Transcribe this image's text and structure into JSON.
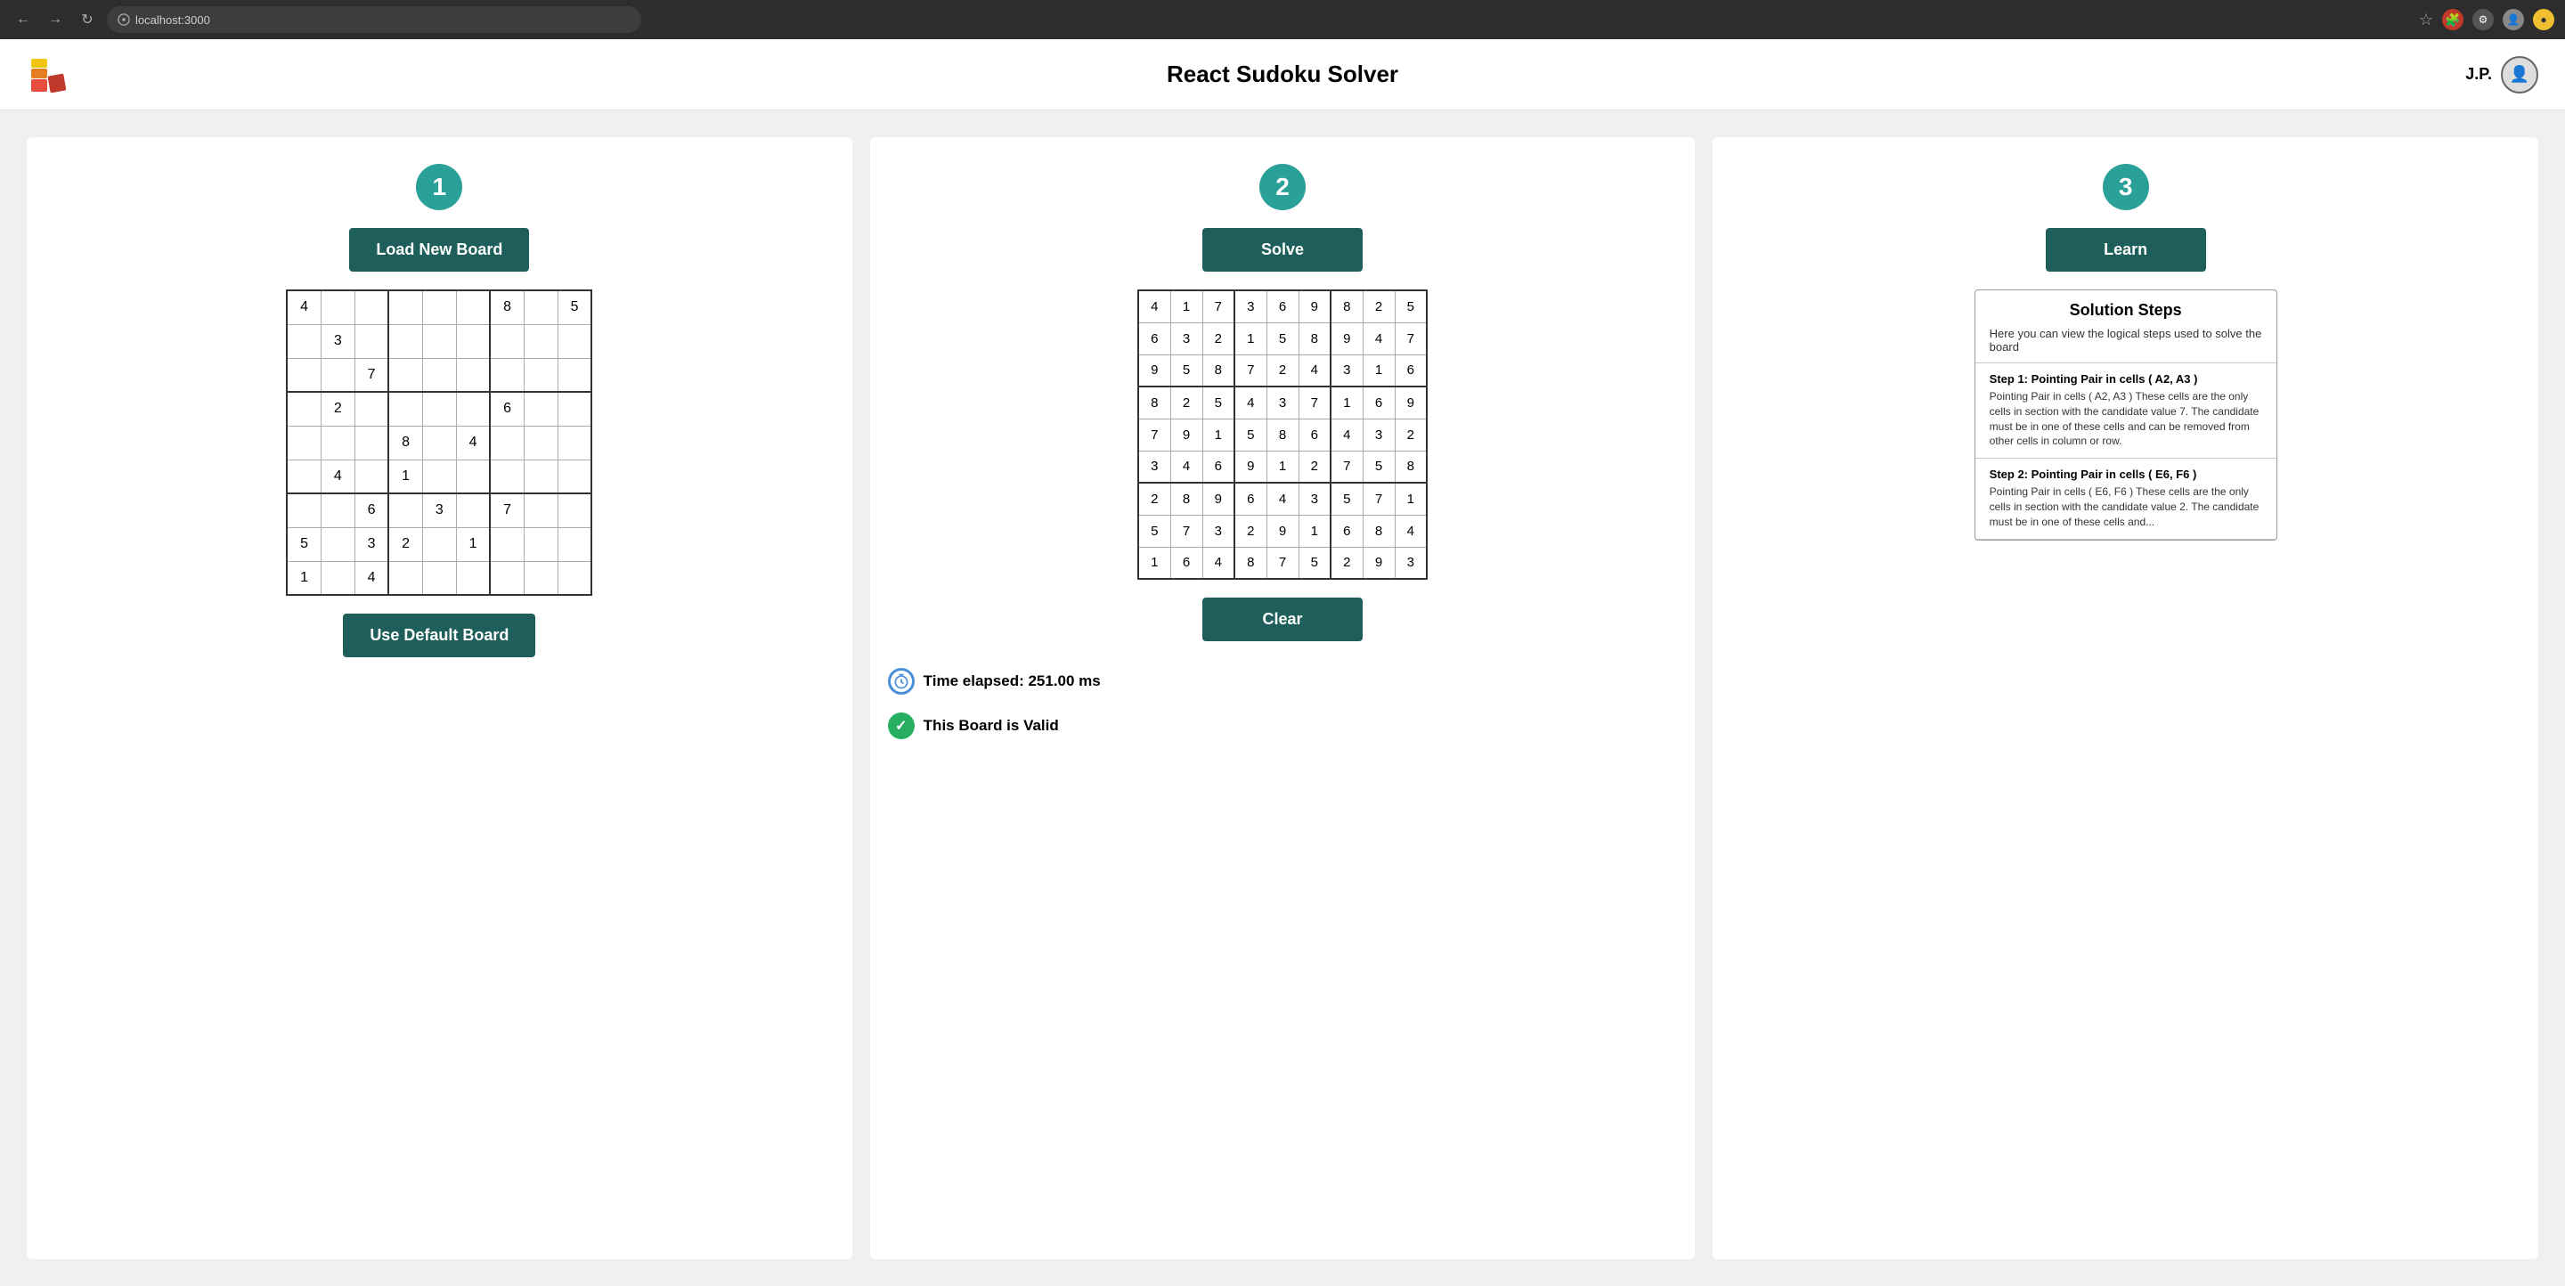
{
  "browser": {
    "url": "localhost:3000",
    "back": "←",
    "forward": "→",
    "reload": "↻"
  },
  "header": {
    "title": "React Sudoku Solver",
    "user_initials": "J.P."
  },
  "panel1": {
    "step": "1",
    "load_btn": "Load New Board",
    "default_btn": "Use Default Board",
    "grid": [
      [
        "4",
        "",
        "",
        "",
        "",
        "",
        "8",
        "",
        "5"
      ],
      [
        "",
        "3",
        "",
        "",
        "",
        "",
        "",
        "",
        ""
      ],
      [
        "",
        "",
        "7",
        "",
        "",
        "",
        "",
        "",
        ""
      ],
      [
        "",
        "2",
        "",
        "",
        "",
        "",
        "6",
        "",
        ""
      ],
      [
        "",
        "",
        "",
        "8",
        "",
        "4",
        "",
        "",
        ""
      ],
      [
        "",
        "4",
        "",
        "1",
        "",
        "",
        "",
        "",
        ""
      ],
      [
        "",
        "",
        "6",
        "",
        "3",
        "",
        "7",
        "",
        ""
      ],
      [
        "5",
        "",
        "3",
        "2",
        "",
        "1",
        "",
        "",
        ""
      ],
      [
        "1",
        "",
        "4",
        "",
        "",
        "",
        "",
        "",
        ""
      ]
    ]
  },
  "panel2": {
    "step": "2",
    "solve_btn": "Solve",
    "clear_btn": "Clear",
    "solved_grid": [
      [
        "4",
        "1",
        "7",
        "3",
        "6",
        "9",
        "8",
        "2",
        "5"
      ],
      [
        "6",
        "3",
        "2",
        "1",
        "5",
        "8",
        "9",
        "4",
        "7"
      ],
      [
        "9",
        "5",
        "8",
        "7",
        "2",
        "4",
        "3",
        "1",
        "6"
      ],
      [
        "8",
        "2",
        "5",
        "4",
        "3",
        "7",
        "1",
        "6",
        "9"
      ],
      [
        "7",
        "9",
        "1",
        "5",
        "8",
        "6",
        "4",
        "3",
        "2"
      ],
      [
        "3",
        "4",
        "6",
        "9",
        "1",
        "2",
        "7",
        "5",
        "8"
      ],
      [
        "2",
        "8",
        "9",
        "6",
        "4",
        "3",
        "5",
        "7",
        "1"
      ],
      [
        "5",
        "7",
        "3",
        "2",
        "9",
        "1",
        "6",
        "8",
        "4"
      ],
      [
        "1",
        "6",
        "4",
        "8",
        "7",
        "5",
        "2",
        "9",
        "3"
      ]
    ],
    "timer_label": "Time elapsed: 251.00 ms",
    "valid_label": "This Board is Valid"
  },
  "panel3": {
    "step": "3",
    "learn_btn": "Learn",
    "solution_title": "Solution Steps",
    "solution_sub": "Here you can view the logical steps used to solve the board",
    "steps": [
      {
        "title": "Step 1: Pointing Pair in cells ( A2, A3 )",
        "body": "Pointing Pair in cells ( A2, A3 ) These cells are the only cells in section with the candidate value 7. The candidate must be in one of these cells and can be removed from other cells in column or row."
      },
      {
        "title": "Step 2: Pointing Pair in cells ( E6, F6 )",
        "body": "Pointing Pair in cells ( E6, F6 ) These cells are the only cells in section with the candidate value 2. The candidate must be in one of these cells and..."
      }
    ]
  },
  "icons": {
    "timer": "🕐",
    "check": "✓",
    "lock": "🔒"
  }
}
